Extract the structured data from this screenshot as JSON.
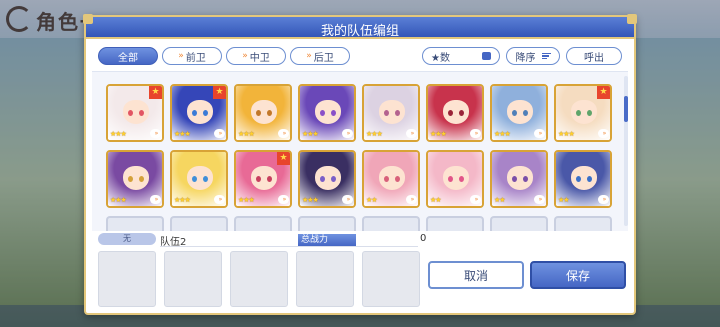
{
  "background": {
    "title": "角色一"
  },
  "dialog": {
    "title": "我的队伍编组"
  },
  "filters": {
    "tabs": [
      {
        "label": "全部",
        "active": true
      },
      {
        "label": "前卫",
        "active": false
      },
      {
        "label": "中卫",
        "active": false
      },
      {
        "label": "后卫",
        "active": false
      }
    ]
  },
  "controls": {
    "sort_key_label": "★数",
    "order_label": "降序",
    "call_label": "呼出"
  },
  "roster": [
    {
      "stars": "★★★",
      "badge": true,
      "hair": "#f3e9ea",
      "eye": "#e25563"
    },
    {
      "stars": "★★★",
      "badge": true,
      "hair": "#3546b8",
      "eye": "#3b7bd6"
    },
    {
      "stars": "★★★",
      "badge": false,
      "hair": "#f2b43a",
      "eye": "#c2782a"
    },
    {
      "stars": "★★★",
      "badge": false,
      "hair": "#6a48b8",
      "eye": "#8a4fc8"
    },
    {
      "stars": "★★★",
      "badge": false,
      "hair": "#dcd2e2",
      "eye": "#b4628f"
    },
    {
      "stars": "★★★",
      "badge": false,
      "hair": "#c8334c",
      "eye": "#9a2338"
    },
    {
      "stars": "★★★",
      "badge": false,
      "hair": "#8fb0dc",
      "eye": "#4f7fb8"
    },
    {
      "stars": "★★★",
      "badge": true,
      "hair": "#f5dcc0",
      "eye": "#5fa46a"
    },
    {
      "stars": "★★★",
      "badge": false,
      "hair": "#7a4aa2",
      "eye": "#d4a13a"
    },
    {
      "stars": "★★★",
      "badge": false,
      "hair": "#f6d660",
      "eye": "#3f8fd8"
    },
    {
      "stars": "★★★",
      "badge": true,
      "hair": "#e86a96",
      "eye": "#c8405e"
    },
    {
      "stars": "★★★",
      "badge": false,
      "hair": "#3a2f62",
      "eye": "#7a5ec8"
    },
    {
      "stars": "★★",
      "badge": false,
      "hair": "#f0a6b8",
      "eye": "#d8607a"
    },
    {
      "stars": "★★",
      "badge": false,
      "hair": "#f4b8c8",
      "eye": "#e25588"
    },
    {
      "stars": "★★",
      "badge": false,
      "hair": "#a884c8",
      "eye": "#7a4fa8"
    },
    {
      "stars": "★★",
      "badge": false,
      "hair": "#4a58a8",
      "eye": "#3a6fc8"
    }
  ],
  "team": {
    "tag": "无",
    "name": "队伍2",
    "power_label": "总战力",
    "power_value": "0"
  },
  "buttons": {
    "cancel": "取消",
    "save": "保存"
  },
  "colors": {
    "accent": "#4566c4",
    "gold_border": "#e3c77b",
    "star": "#ffcf2e",
    "badge": "#e8442c"
  }
}
